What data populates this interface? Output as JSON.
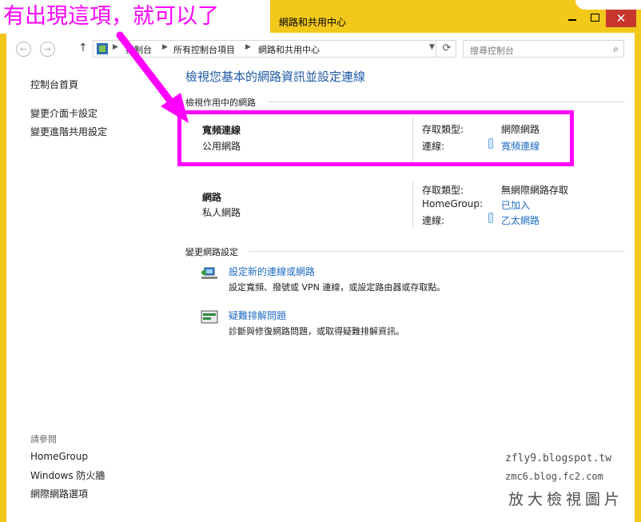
{
  "annotation": {
    "text": "有出現這項，就可以了",
    "color": "#ff00ff"
  },
  "window": {
    "title": "網路和共用中心"
  },
  "title_buttons": {
    "close": "✕"
  },
  "address": {
    "crumbs": [
      "控制台",
      "所有控制台項目",
      "網路和共用中心"
    ],
    "search_placeholder": "搜尋控制台"
  },
  "sidebar": {
    "items": [
      {
        "label": "控制台首頁"
      },
      {
        "label": "變更介面卡設定"
      },
      {
        "label": "變更進階共用設定"
      }
    ],
    "see_also_title": "請參閱",
    "see_also": [
      {
        "label": "HomeGroup"
      },
      {
        "label": "Windows 防火牆"
      },
      {
        "label": "網際網路選項"
      }
    ]
  },
  "main": {
    "title": "檢視您基本的網路資訊並設定連線",
    "active_section": "檢視作用中的網路",
    "networks": [
      {
        "name": "寬頻連線",
        "type": "公用網路",
        "access_type_label": "存取類型:",
        "access_type": "網際網路",
        "connection_label": "連線:",
        "connection": "寬頻連線"
      },
      {
        "name": "網路",
        "type": "私人網路",
        "access_type_label": "存取類型:",
        "access_type": "無網際網路存取",
        "homegroup_label": "HomeGroup:",
        "homegroup": "已加入",
        "connection_label": "連線:",
        "connection": "乙太網路"
      }
    ],
    "change_section": "變更網路設定",
    "tasks": [
      {
        "link": "設定新的連線或網路",
        "desc": "設定寬頻、撥號或 VPN 連線，或設定路由器或存取點。"
      },
      {
        "link": "疑難排解問題",
        "desc": "診斷與修復網路問題，或取得疑難排解資訊。"
      }
    ]
  },
  "watermark": {
    "line1": "zfly9.blogspot.tw",
    "line2": "zmc6.blog.fc2.com",
    "line3": "放大檢視圖片"
  },
  "colors": {
    "frame": "#f2c81b",
    "link": "#1e6bc4",
    "highlight": "#ff00ff",
    "close": "#c7372f"
  }
}
